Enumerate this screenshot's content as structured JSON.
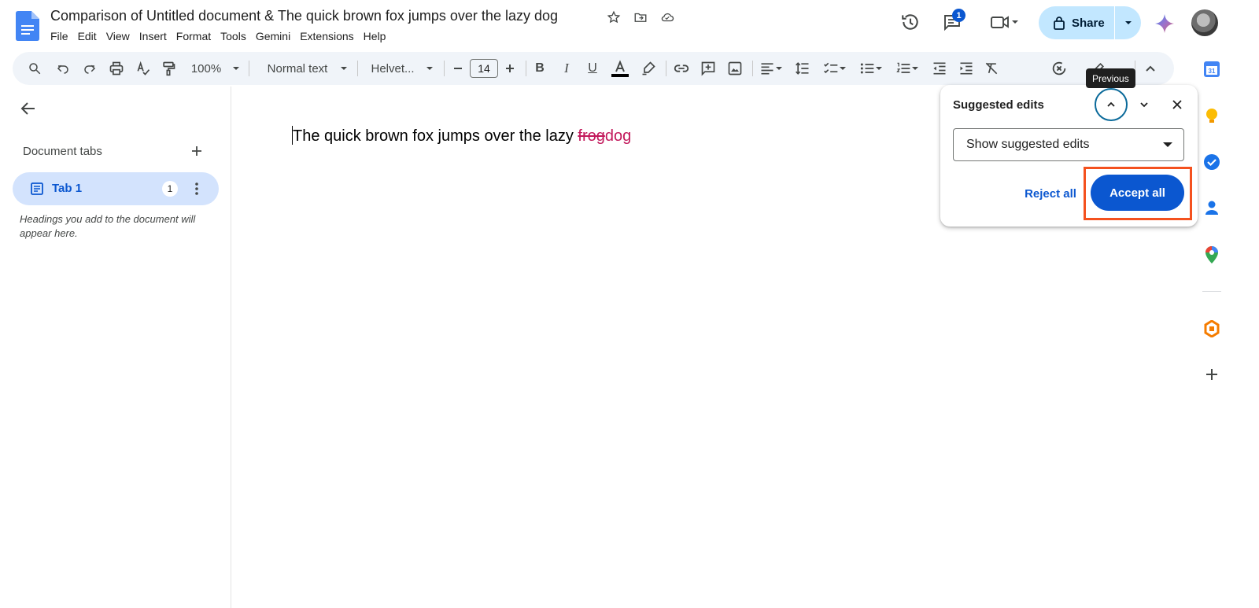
{
  "document": {
    "title": "Comparison of Untitled document & The quick brown fox jumps over the lazy dog",
    "body_prefix": "The quick brown fox jumps over the lazy ",
    "deleted_text": "frog",
    "inserted_text": "dog"
  },
  "menu": [
    "File",
    "Edit",
    "View",
    "Insert",
    "Format",
    "Tools",
    "Gemini",
    "Extensions",
    "Help"
  ],
  "header": {
    "comments_badge": "1",
    "share_label": "Share"
  },
  "toolbar": {
    "zoom": "100%",
    "style": "Normal text",
    "font": "Helvet...",
    "font_size": "14",
    "text_color": "#000000"
  },
  "outline": {
    "section_label": "Document tabs",
    "tab_label": "Tab 1",
    "tab_count": "1",
    "hint": "Headings you add to the document will appear here."
  },
  "suggestions_panel": {
    "title": "Suggested edits",
    "mode": "Show suggested edits",
    "reject_label": "Reject all",
    "accept_label": "Accept all",
    "tooltip": "Previous"
  },
  "colors": {
    "accent": "#0b57d0",
    "share_bg": "#c2e7ff",
    "suggestion": "#c2185b",
    "highlight_box": "#f4511e"
  }
}
